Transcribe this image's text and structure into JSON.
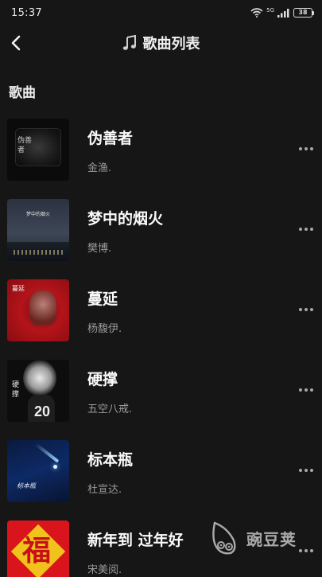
{
  "status": {
    "time": "15:37",
    "network": "5G",
    "battery": "38"
  },
  "nav": {
    "title": "歌曲列表",
    "back_icon": "chevron-left-icon",
    "title_icon": "music-note-icon"
  },
  "section": {
    "title": "歌曲"
  },
  "songs": [
    {
      "title": "伪善者",
      "artist": "金渔.",
      "cover_text": "伪善者"
    },
    {
      "title": "梦中的烟火",
      "artist": "樊博.",
      "cover_text": "梦中的烟火"
    },
    {
      "title": "蔓延",
      "artist": "杨馥伊.",
      "cover_text": "蔓延"
    },
    {
      "title": "硬撑",
      "artist": "五空八戒.",
      "cover_text": "硬撑"
    },
    {
      "title": "标本瓶",
      "artist": "杜宣达.",
      "cover_text": "标本瓶"
    },
    {
      "title": "新年到 过年好",
      "artist": "宋美阅.",
      "cover_text": "福"
    }
  ],
  "watermark": {
    "text": "豌豆荚"
  }
}
